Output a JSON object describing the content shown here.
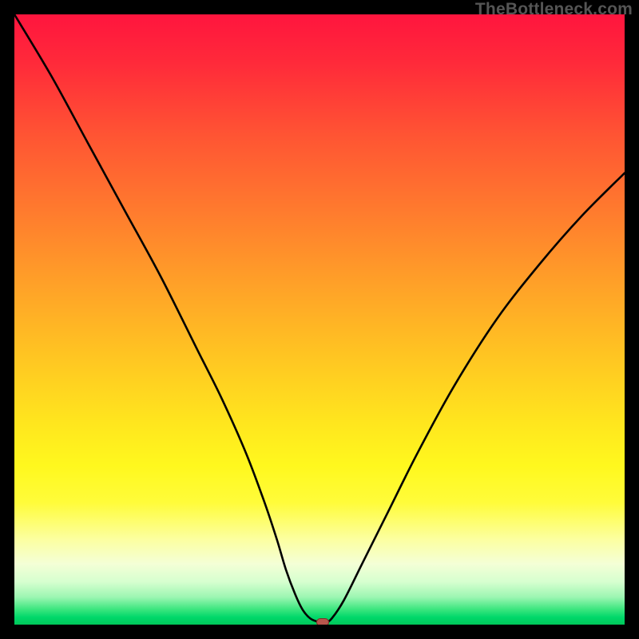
{
  "watermark": {
    "text": "TheBottleneck.com"
  },
  "colors": {
    "curve_stroke": "#000000",
    "marker_fill": "#b8564c",
    "marker_stroke": "#7a2f28"
  },
  "chart_data": {
    "type": "line",
    "title": "",
    "xlabel": "",
    "ylabel": "",
    "xlim": [
      0,
      100
    ],
    "ylim": [
      0,
      100
    ],
    "grid": false,
    "series": [
      {
        "name": "bottleneck-curve",
        "x": [
          0,
          6,
          12,
          18,
          24,
          30,
          34,
          38,
          41,
          43,
          44.5,
          46,
          47.2,
          48.5,
          50,
          51,
          52,
          54,
          57,
          61,
          66,
          72,
          79,
          86,
          93,
          100
        ],
        "values": [
          100,
          90,
          79,
          68,
          57,
          45,
          37,
          28,
          20,
          14,
          9,
          5,
          2.5,
          1,
          0.4,
          0.4,
          1,
          4,
          10,
          18,
          28,
          39,
          50,
          59,
          67,
          74
        ]
      }
    ],
    "annotations": [
      {
        "name": "bottleneck-marker",
        "x": 50.5,
        "y": 0.4
      }
    ]
  }
}
